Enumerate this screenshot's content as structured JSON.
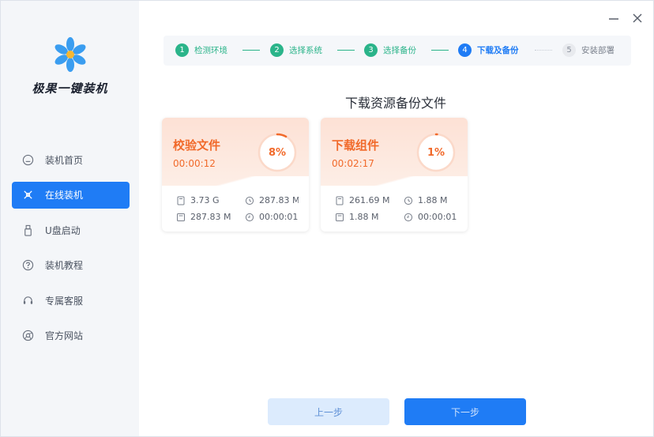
{
  "app": {
    "name": "极果一键装机"
  },
  "sidebar": {
    "items": [
      {
        "label": "装机首页",
        "icon": "home-icon",
        "active": false
      },
      {
        "label": "在线装机",
        "icon": "online-install-icon",
        "active": true
      },
      {
        "label": "U盘启动",
        "icon": "usb-icon",
        "active": false
      },
      {
        "label": "装机教程",
        "icon": "help-icon",
        "active": false
      },
      {
        "label": "专属客服",
        "icon": "headset-icon",
        "active": false
      },
      {
        "label": "官方网站",
        "icon": "browser-icon",
        "active": false
      }
    ]
  },
  "stepper": {
    "steps": [
      {
        "num": "1",
        "label": "检测环境",
        "state": "done"
      },
      {
        "num": "2",
        "label": "选择系统",
        "state": "done"
      },
      {
        "num": "3",
        "label": "选择备份",
        "state": "done"
      },
      {
        "num": "4",
        "label": "下载及备份",
        "state": "current"
      },
      {
        "num": "5",
        "label": "安装部署",
        "state": "todo"
      }
    ]
  },
  "main": {
    "title": "下载资源备份文件"
  },
  "cards": [
    {
      "title": "校验文件",
      "time": "00:00:12",
      "percent_label": "8%",
      "progress": 0.08,
      "stats": {
        "size_total": "3.73 G",
        "speed": "287.83 M",
        "size_done": "287.83 M",
        "remaining": "00:00:01"
      }
    },
    {
      "title": "下载组件",
      "time": "00:02:17",
      "percent_label": "1%",
      "progress": 0.01,
      "stats": {
        "size_total": "261.69 M",
        "speed": "1.88 M",
        "size_done": "1.88 M",
        "remaining": "00:00:01"
      }
    }
  ],
  "buttons": {
    "prev": "上一步",
    "next": "下一步"
  },
  "colors": {
    "accent": "#1f7cf5",
    "step_done": "#2bb48a",
    "progress": "#f16a2b",
    "card_bg": "#fde1d5"
  }
}
